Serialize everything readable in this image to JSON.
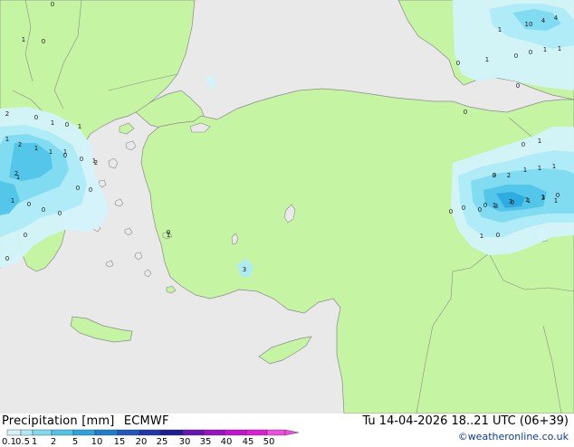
{
  "title": {
    "product": "Precipitation [mm]",
    "model": "ECMWF",
    "valid": "Tu 14-04-2026 18..21 UTC (06+39)"
  },
  "credit": "©weatheronline.co.uk",
  "colors": {
    "sea": "#e9e9e9",
    "land": "#c5f5a3",
    "border": "#8a8a8a"
  },
  "legend": {
    "ticks": [
      "0.1",
      "0.5",
      "1",
      "2",
      "5",
      "10",
      "15",
      "20",
      "25",
      "30",
      "35",
      "40",
      "45",
      "50"
    ],
    "colors": [
      "#d4f3fb",
      "#aeebf7",
      "#7fdbf0",
      "#4fc3e8",
      "#28a6dd",
      "#1a7ecf",
      "#1c58c0",
      "#1f37ae",
      "#1d1b98",
      "#6a13b8",
      "#9c10c9",
      "#c80fd6",
      "#e21ad8",
      "#f04ce0"
    ]
  },
  "map_values": [
    "0",
    "1",
    "0",
    "2",
    "2",
    "1",
    "1",
    "0",
    "0",
    "2",
    "1",
    "0",
    "1",
    "0",
    "1",
    "2",
    "0",
    "0",
    "0",
    "0",
    "0",
    "0",
    "0",
    "1",
    "1",
    "1",
    "1",
    "0",
    "1",
    "0",
    "0",
    "0",
    "1",
    "0",
    "3",
    "2",
    "1",
    "1",
    "1",
    "0",
    "1",
    "1",
    "3",
    "3",
    "1",
    "3",
    "1",
    "0",
    "1",
    "10",
    "4",
    "4",
    "0",
    "1",
    "0",
    "0",
    "1",
    "1",
    "0",
    "0",
    "3",
    "0",
    "0",
    "1",
    "1",
    "0"
  ]
}
